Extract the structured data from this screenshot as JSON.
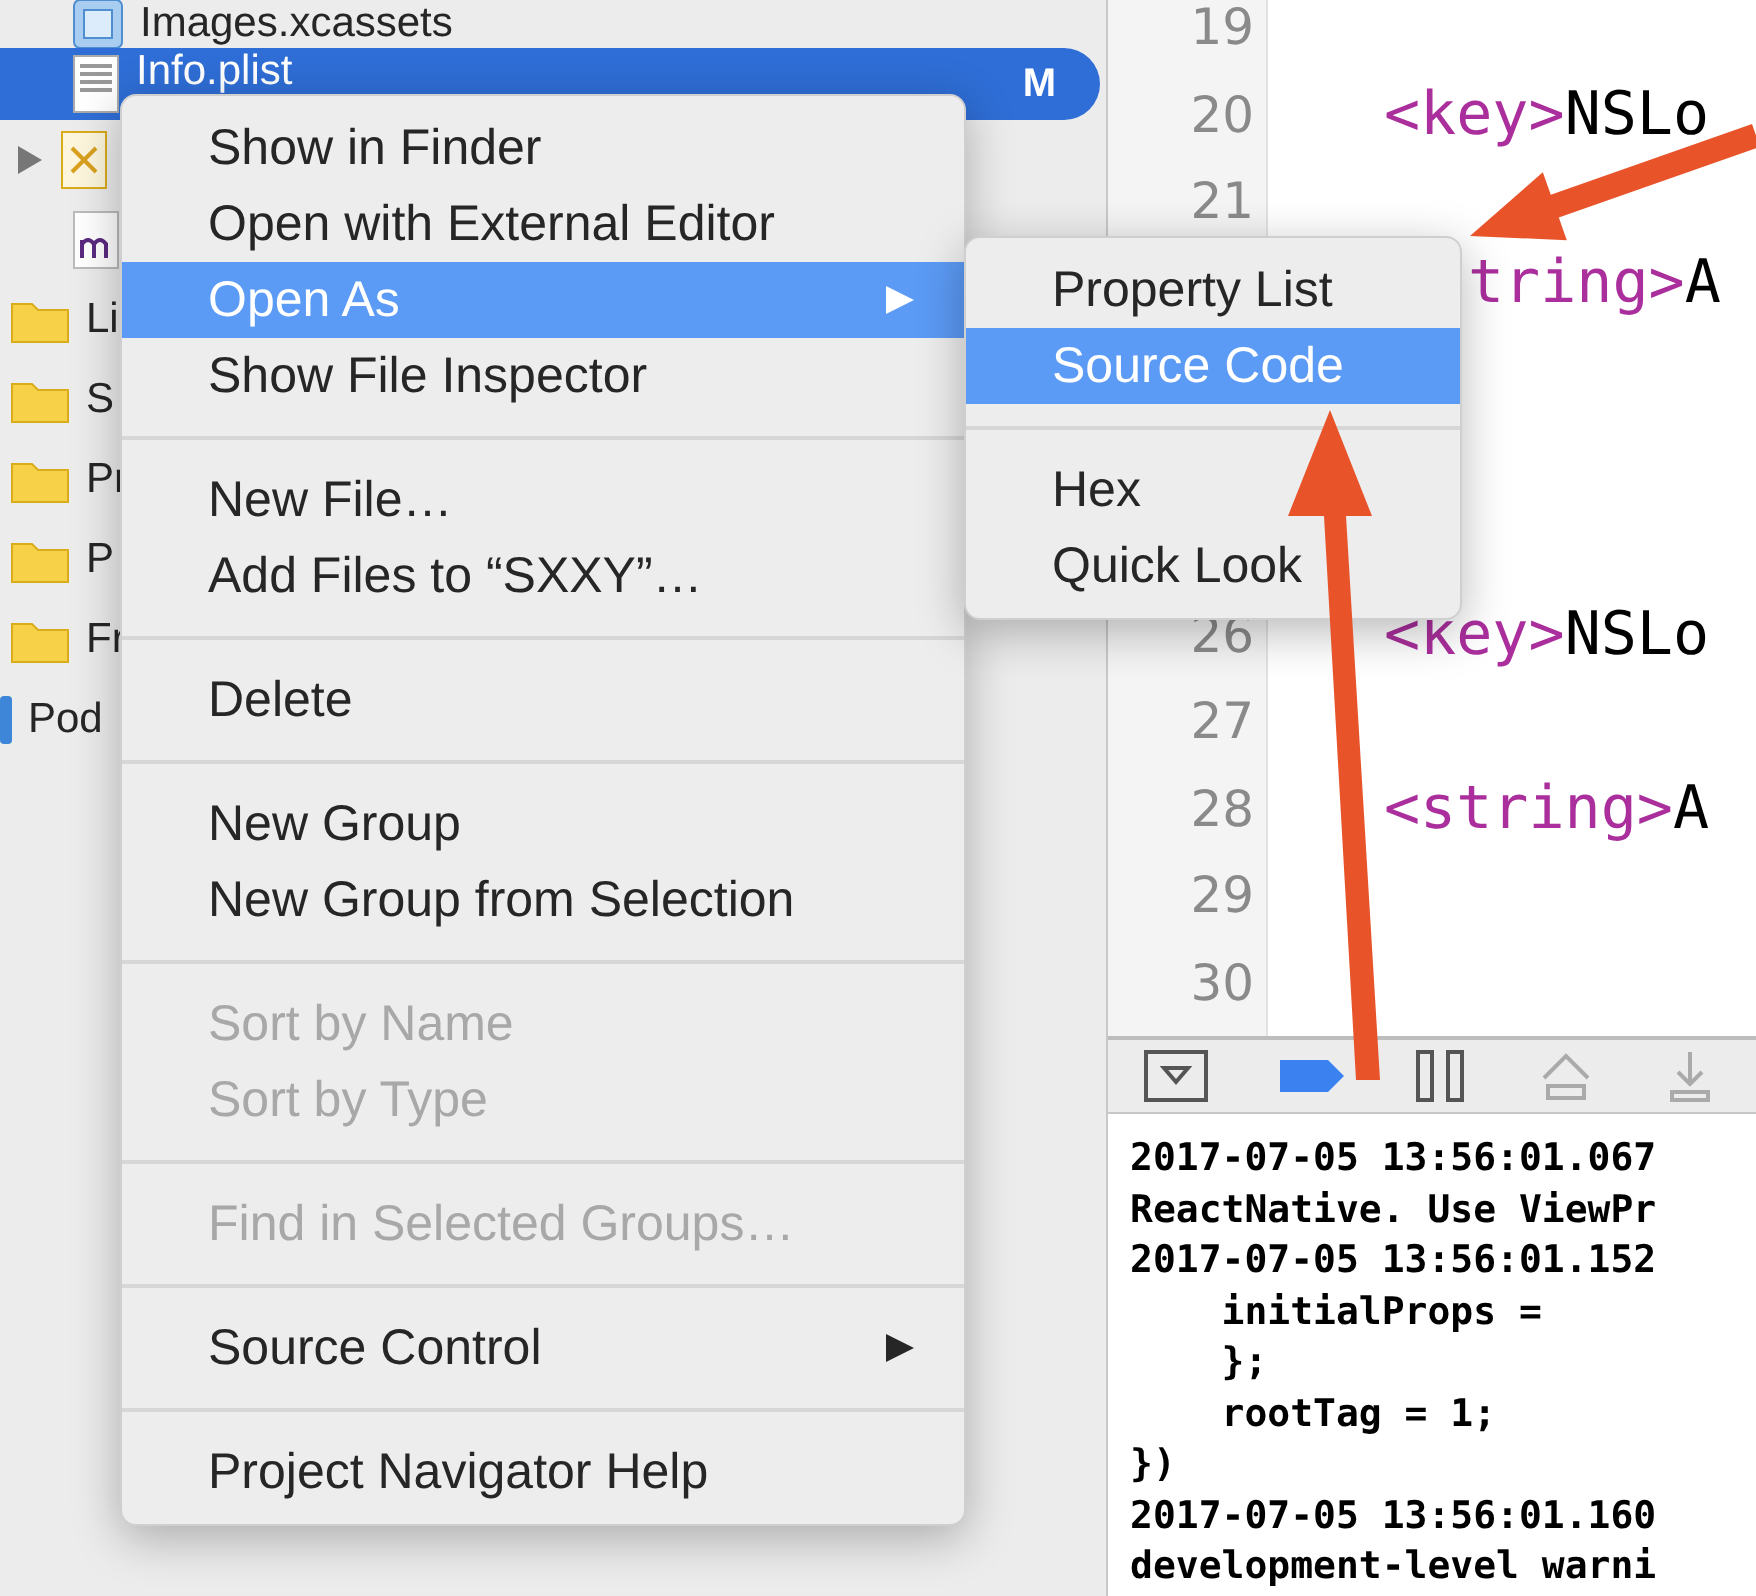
{
  "navigator": {
    "items": [
      {
        "name": "Images.xcassets",
        "kind": "assets",
        "selected": false
      },
      {
        "name": "Info.plist",
        "kind": "plist",
        "selected": true,
        "badge": "M"
      },
      {
        "kind": "xib",
        "selected": false,
        "expandable": true
      },
      {
        "kind": "mfile",
        "selected": false
      },
      {
        "name": "Li",
        "kind": "folder",
        "selected": false
      },
      {
        "name": "S",
        "kind": "folder",
        "selected": false
      },
      {
        "name": "Pr",
        "kind": "folder",
        "selected": false
      },
      {
        "name": "P",
        "kind": "folder",
        "selected": false
      },
      {
        "name": "Fr",
        "kind": "folder",
        "selected": false
      },
      {
        "name": "Pod",
        "kind": "project",
        "selected": false
      }
    ]
  },
  "editor": {
    "lines": [
      {
        "number": "19"
      },
      {
        "number": "20",
        "tag": "<key>",
        "text": "NSLo"
      },
      {
        "number": "21"
      },
      {
        "tag": "tring>",
        "text": "A",
        "kind": "cut"
      },
      {
        "number": "26",
        "tag": "<key>",
        "text": "NSLo"
      },
      {
        "number": "27"
      },
      {
        "number": "28",
        "tag": "<string>",
        "text": "A"
      },
      {
        "number": "29"
      },
      {
        "number": "30"
      }
    ]
  },
  "console": {
    "lines": [
      "2017-07-05 13:56:01.067",
      "ReactNative. Use ViewPr",
      "2017-07-05 13:56:01.152",
      "    initialProps =",
      "    };",
      "    rootTag = 1;",
      "})",
      "2017-07-05 13:56:01.160",
      "development-level warni"
    ]
  },
  "context_menu": {
    "items": [
      {
        "kind": "item",
        "label": "Show in Finder",
        "selected": false,
        "disabled": false
      },
      {
        "kind": "item",
        "label": "Open with External Editor",
        "selected": false,
        "disabled": false
      },
      {
        "kind": "item",
        "label": "Open As",
        "selected": true,
        "disabled": false,
        "submenu": true
      },
      {
        "kind": "item",
        "label": "Show File Inspector",
        "selected": false,
        "disabled": false
      },
      {
        "kind": "separator"
      },
      {
        "kind": "item",
        "label": "New File…",
        "selected": false,
        "disabled": false
      },
      {
        "kind": "item",
        "label": "Add Files to “SXXY”…",
        "selected": false,
        "disabled": false
      },
      {
        "kind": "separator"
      },
      {
        "kind": "item",
        "label": "Delete",
        "selected": false,
        "disabled": false
      },
      {
        "kind": "separator"
      },
      {
        "kind": "item",
        "label": "New Group",
        "selected": false,
        "disabled": false
      },
      {
        "kind": "item",
        "label": "New Group from Selection",
        "selected": false,
        "disabled": false
      },
      {
        "kind": "separator"
      },
      {
        "kind": "item",
        "label": "Sort by Name",
        "selected": false,
        "disabled": true
      },
      {
        "kind": "item",
        "label": "Sort by Type",
        "selected": false,
        "disabled": true
      },
      {
        "kind": "separator"
      },
      {
        "kind": "item",
        "label": "Find in Selected Groups…",
        "selected": false,
        "disabled": true
      },
      {
        "kind": "separator"
      },
      {
        "kind": "item",
        "label": "Source Control",
        "selected": false,
        "disabled": false,
        "submenu": true
      },
      {
        "kind": "separator"
      },
      {
        "kind": "item",
        "label": "Project Navigator Help",
        "selected": false,
        "disabled": false
      }
    ]
  },
  "submenu": {
    "items": [
      {
        "kind": "item",
        "label": "Property List",
        "selected": false
      },
      {
        "kind": "item",
        "label": "Source Code",
        "selected": true
      },
      {
        "kind": "separator"
      },
      {
        "kind": "item",
        "label": "Hex",
        "selected": false
      },
      {
        "kind": "item",
        "label": "Quick Look",
        "selected": false
      }
    ]
  }
}
